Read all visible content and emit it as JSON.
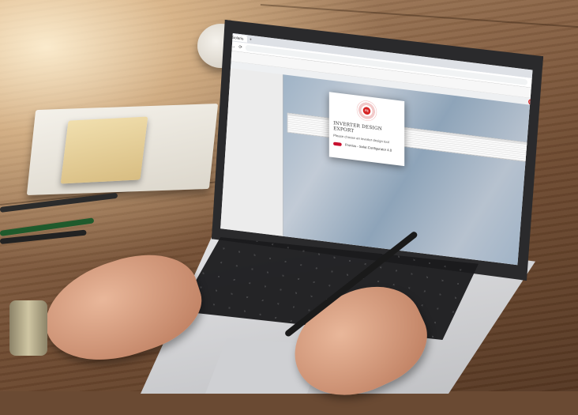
{
  "browser": {
    "tab_label": "Solaris",
    "url": "",
    "profile_initial": ""
  },
  "app": {
    "toolbar_items": [
      "",
      "",
      "",
      ""
    ],
    "header_left": "",
    "header_right": "",
    "brand_initials": "FE"
  },
  "sidebar": {
    "title": "",
    "items": [
      "",
      "",
      "",
      "",
      "",
      ""
    ],
    "buttons": [
      "",
      "",
      ""
    ]
  },
  "grid": {
    "headers": [
      "",
      "",
      "",
      ""
    ],
    "rows": [
      [
        "",
        "",
        "",
        ""
      ],
      [
        "",
        "",
        "",
        ""
      ],
      [
        "",
        "",
        "",
        ""
      ],
      [
        "",
        "",
        "",
        ""
      ],
      [
        "",
        "",
        "",
        ""
      ],
      [
        "",
        "",
        "",
        ""
      ],
      [
        "",
        "",
        "",
        ""
      ],
      [
        "",
        "",
        "",
        ""
      ]
    ]
  },
  "modal": {
    "title": "INVERTER DESIGN EXPORT",
    "subtitle": "Please choose an inverter design tool",
    "option_label": "Fronius - Solar.Configurator 4.0",
    "logo_text": "FE"
  },
  "colors": {
    "brand_red": "#d21f1f",
    "fronius_red": "#c8102e"
  }
}
